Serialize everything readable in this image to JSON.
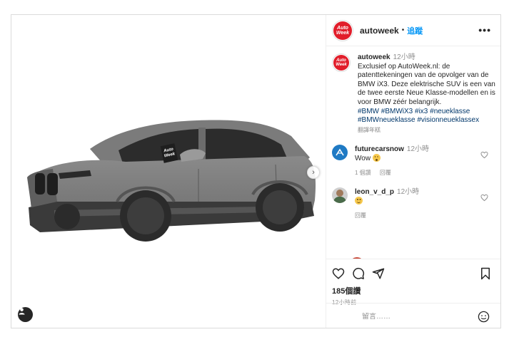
{
  "post": {
    "username": "autoweek",
    "follow_label": "追蹤",
    "more_label": "•••",
    "avatar_logo_line1": "Auto",
    "avatar_logo_line2": "Week",
    "media_watermark_line1": "Auto",
    "media_watermark_line2": "Week",
    "next_arrow": "›"
  },
  "caption": {
    "username": "autoweek",
    "time": "12小時",
    "text": "Exclusief op AutoWeek.nl: de patenttekeningen van de opvolger van de BMW iX3. Deze elektrische SUV is een van de twee eerste Neue Klasse-modellen en is voor BMW zéér belangrijk.",
    "hashtags": [
      "#BMW",
      "#BMWiX3",
      "#ix3",
      "#neueklasse",
      "#BMWneueklasse",
      "#visionneueklassex"
    ],
    "translate_label": "翻譯年糕"
  },
  "comments": [
    {
      "username": "futurecarsnow",
      "time": "12小時",
      "text": "Wow",
      "emoji": "wow-emoji",
      "likes_label": "1 個讚",
      "reply_label": "回覆"
    },
    {
      "username": "leon_v_d_p",
      "time": "12小時",
      "text": "",
      "emoji": "smile-emoji",
      "reply_label": "回覆"
    }
  ],
  "actions": {
    "likes": "185個讚",
    "posted_time": "12小時前"
  },
  "add_comment": {
    "placeholder": "留言……"
  },
  "colors": {
    "brand_red": "#e11d2a",
    "link_blue": "#0095f6",
    "hashtag_blue": "#00376b",
    "muted_gray": "#8e8e8e"
  },
  "icons": [
    "tag-user-icon",
    "heart-icon",
    "comment-icon",
    "share-icon",
    "bookmark-icon",
    "emoji-icon",
    "more-options-icon"
  ]
}
